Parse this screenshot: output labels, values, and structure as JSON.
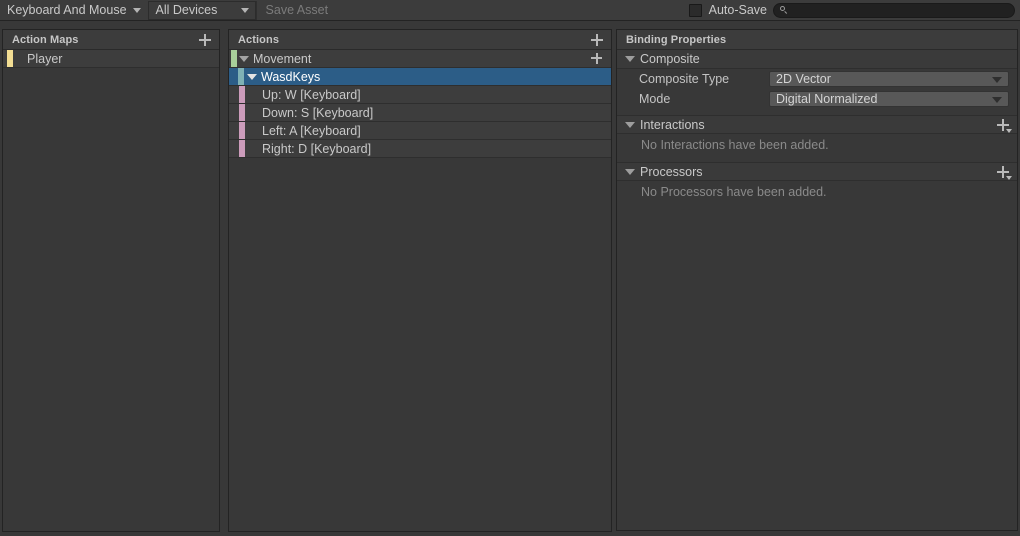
{
  "toolbar": {
    "control_scheme": "Keyboard And Mouse",
    "device_filter": "All Devices",
    "save_asset_label": "Save Asset",
    "autosave_label": "Auto-Save",
    "autosave_checked": false,
    "search_value": "",
    "search_placeholder": ""
  },
  "action_maps": {
    "header": "Action Maps",
    "add_label": "+",
    "items": [
      {
        "label": "Player",
        "strip_color": "#f2dd93",
        "selected": false
      }
    ]
  },
  "actions": {
    "header": "Actions",
    "add_label": "+",
    "tree": [
      {
        "label": "Movement",
        "type": "action",
        "strip_color": "#a8cf9a",
        "expanded": true,
        "selected": false,
        "has_add": true,
        "indent": 10
      },
      {
        "label": "WasdKeys",
        "type": "composite",
        "strip_color": "#7fb1b5",
        "expanded": true,
        "selected": true,
        "has_add": false,
        "indent": 18
      },
      {
        "label": "Up: W [Keyboard]",
        "type": "binding",
        "strip_color": "#cc9cbb",
        "expanded": false,
        "selected": false,
        "has_add": false,
        "indent": 22
      },
      {
        "label": "Down: S [Keyboard]",
        "type": "binding",
        "strip_color": "#cc9cbb",
        "expanded": false,
        "selected": false,
        "has_add": false,
        "indent": 22
      },
      {
        "label": "Left: A [Keyboard]",
        "type": "binding",
        "strip_color": "#cc9cbb",
        "expanded": false,
        "selected": false,
        "has_add": false,
        "indent": 22
      },
      {
        "label": "Right: D [Keyboard]",
        "type": "binding",
        "strip_color": "#cc9cbb",
        "expanded": false,
        "selected": false,
        "has_add": false,
        "indent": 22
      }
    ]
  },
  "properties": {
    "header": "Binding Properties",
    "composite": {
      "title": "Composite",
      "fields": [
        {
          "label": "Composite Type",
          "value": "2D Vector"
        },
        {
          "label": "Mode",
          "value": "Digital Normalized"
        }
      ]
    },
    "interactions": {
      "title": "Interactions",
      "empty_message": "No Interactions have been added."
    },
    "processors": {
      "title": "Processors",
      "empty_message": "No Processors have been added."
    }
  },
  "colors": {
    "selection": "#2c5d87",
    "panel_bg": "#383838",
    "toolbar_bg": "#3c3c3c",
    "row_bg": "#3d3d3d"
  }
}
